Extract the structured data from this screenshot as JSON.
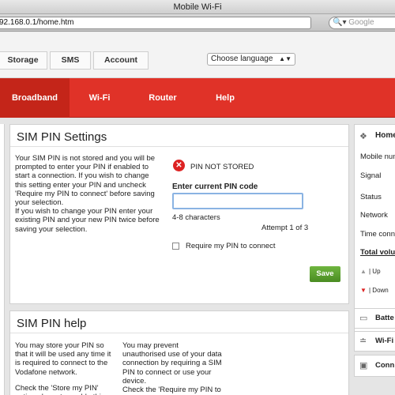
{
  "window": {
    "title": "Mobile Wi-Fi"
  },
  "browser": {
    "url": "92.168.0.1/home.htm",
    "search_placeholder": "Google",
    "search_icon": "magnifier-icon"
  },
  "top_tabs": [
    "Storage",
    "SMS",
    "Account"
  ],
  "language": {
    "selected": "Choose language"
  },
  "nav": [
    "Broadband",
    "Wi-Fi",
    "Router",
    "Help"
  ],
  "sim_pin_settings": {
    "title": "SIM PIN Settings",
    "description_1": "Your SIM PIN is not stored and you will be prompted to enter your PIN if enabled to start a connection. If you wish to change this setting enter your PIN and uncheck 'Require my PIN to connect' before saving your selection.",
    "description_2": "If you wish to change your PIN enter your existing PIN and your new PIN twice before saving your selection.",
    "status": "PIN NOT STORED",
    "field_label": "Enter current PIN code",
    "field_value": "",
    "hint": "4-8 characters",
    "attempt": "Attempt 1 of 3",
    "checkbox_label": "Require my PIN to connect",
    "checkbox_checked": false,
    "save": "Save"
  },
  "sim_pin_help": {
    "title": "SIM PIN help",
    "col1": "You may store your PIN so that it will be used any time it is required to connect to the Vodafone network.",
    "col1b": "Check the 'Store my PIN' option above to enable this",
    "col2": "You may prevent unauthorised use of your data connection by requiring a SIM PIN to connect or use your device.",
    "col2b": "Check the 'Require my PIN to"
  },
  "sidebar": {
    "home": "Home",
    "rows": [
      "Mobile num",
      "Signal",
      "Status",
      "Network",
      "Time conn"
    ],
    "total": "Total volu",
    "up": "| Up",
    "down": "| Down",
    "battery": "Batte",
    "wifi": "Wi-Fi",
    "connections": "Conn"
  }
}
